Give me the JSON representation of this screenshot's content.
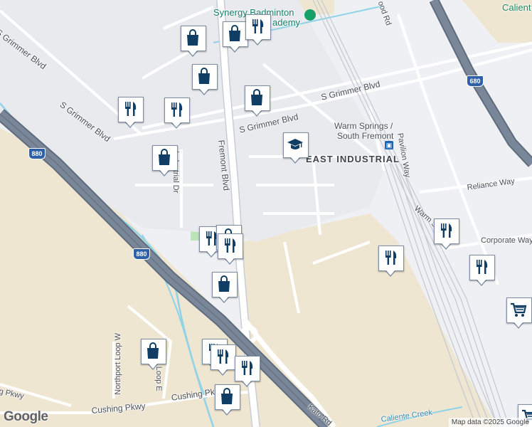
{
  "map": {
    "attribution": "Map data ©2025 Google",
    "logo": "Google",
    "labels": {
      "s_grimmer_blvd_nw": "S Grimmer Blvd",
      "s_grimmer_blvd_mid": "S Grimmer Blvd",
      "s_grimmer_blvd_east": "S Grimmer Blvd",
      "fremont_blvd": "Fremont Blvd",
      "industrial_dr": "Industrial Dr",
      "warm_springs": "Warm Springs /",
      "south_fremont": "South Fremont",
      "east_industrial": "EAST INDUSTRIAL",
      "pavilion_way": "Pavilion Way",
      "reliance_way": "Reliance Way",
      "corporate_way": "Corporate Way",
      "warm_s": "Warm S",
      "ood_rd": "ood Rd",
      "caliente": "Calient",
      "synergy": "Synergy Badminton",
      "academy": "ademy",
      "northport_loop_w": "Northport Loop W",
      "port_loop_e": "rt Loop E",
      "cushing_pkwy_left": "g Pkwy",
      "cushing_pkwy": "Cushing Pkwy",
      "cushing_pk": "Cushing Pk",
      "kato_rd": "Kato Rd",
      "caliente_creek": "Caliente Creek"
    },
    "shields": {
      "i880_top": "880",
      "i880_mid": "880",
      "i680": "680"
    },
    "colors": {
      "background": "#eef0f3",
      "highway": "#7a8799",
      "highway_edge": "#5f6c7e",
      "water": "#8fd3e8",
      "land_tan": "#efe6d2",
      "park": "#bde3b8",
      "pin_icon": "#0f3d63",
      "road": "#ffffff"
    },
    "pins": [
      {
        "kind": "shopping",
        "icon": "shopping-bag-icon"
      },
      {
        "kind": "shopping",
        "icon": "shopping-bag-icon"
      },
      {
        "kind": "restaurant",
        "icon": "fork-knife-icon"
      },
      {
        "kind": "shopping",
        "icon": "shopping-bag-icon"
      },
      {
        "kind": "shopping",
        "icon": "shopping-bag-icon"
      },
      {
        "kind": "restaurant",
        "icon": "fork-knife-icon"
      },
      {
        "kind": "restaurant",
        "icon": "fork-knife-icon"
      },
      {
        "kind": "shopping",
        "icon": "shopping-bag-icon"
      },
      {
        "kind": "school",
        "icon": "graduation-cap-icon"
      },
      {
        "kind": "restaurant",
        "icon": "fork-knife-icon"
      },
      {
        "kind": "shopping",
        "icon": "shopping-bag-icon"
      },
      {
        "kind": "restaurant",
        "icon": "fork-knife-icon"
      },
      {
        "kind": "shopping",
        "icon": "shopping-bag-icon"
      },
      {
        "kind": "restaurant",
        "icon": "fork-knife-icon"
      },
      {
        "kind": "restaurant",
        "icon": "fork-knife-icon"
      },
      {
        "kind": "restaurant",
        "icon": "fork-knife-icon"
      },
      {
        "kind": "grocery",
        "icon": "shopping-cart-icon"
      },
      {
        "kind": "shopping",
        "icon": "shopping-bag-icon"
      },
      {
        "kind": "restaurant",
        "icon": "fork-knife-icon"
      },
      {
        "kind": "restaurant",
        "icon": "fork-knife-icon"
      },
      {
        "kind": "restaurant",
        "icon": "fork-knife-icon"
      },
      {
        "kind": "shopping",
        "icon": "shopping-bag-icon"
      },
      {
        "kind": "grocery",
        "icon": "shopping-cart-icon"
      }
    ]
  }
}
